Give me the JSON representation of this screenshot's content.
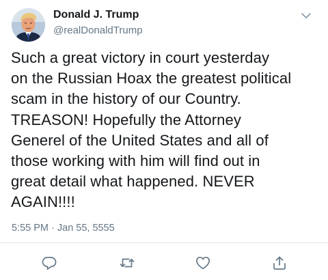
{
  "author": {
    "display_name": "Donald J. Trump",
    "handle": "@realDonaldTrump",
    "avatar_icon": "profile-photo"
  },
  "tweet": {
    "lines": [
      "Such a great victory in court yesterday",
      "on the Russian Hoax the greatest political",
      "scam in the history of our Country.",
      "TREASON! Hopefully the Attorney",
      "Generel of the United States and all of",
      "those working with him will find out in",
      "great detail what happened. NEVER",
      "AGAIN!!!!"
    ],
    "timestamp": "5:55 PM · Jan 55, 5555"
  },
  "actions": [
    {
      "name": "reply",
      "icon": "reply-icon"
    },
    {
      "name": "retweet",
      "icon": "retweet-icon"
    },
    {
      "name": "like",
      "icon": "heart-icon"
    },
    {
      "name": "share",
      "icon": "share-icon"
    }
  ],
  "colors": {
    "text": "#14171a",
    "secondary": "#657786",
    "divider": "#e1e8ed",
    "icon": "#657786"
  }
}
